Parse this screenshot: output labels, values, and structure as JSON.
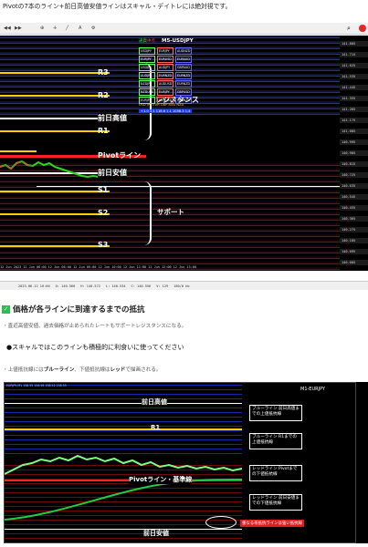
{
  "header": {
    "title": "Pivotの7本のライン+前日高値安値ラインはスキャル・デイトレには絶対視です。"
  },
  "toolbar": {
    "icons": [
      "left-arrow-icon",
      "right-arrow-icon",
      "zoom-in-icon",
      "crosshair-icon",
      "trendline-icon",
      "text-icon",
      "settings-icon"
    ]
  },
  "chart1": {
    "symbol": "M5-USDJPY",
    "top_labels": [
      "通貨",
      "中点"
    ],
    "labels": {
      "r3": "R3",
      "r2": "R2",
      "prev_high": "前日高値",
      "r1": "R1",
      "pivot": "Pivotライン",
      "prev_low": "前日安値",
      "s1": "S1",
      "s2": "S2",
      "s3": "S3"
    },
    "resistance": "レジスタンス",
    "support": "サポート",
    "currency_strip": "USD JPY EUR GBP AUD NZD",
    "currency_values": "+1.0  3.1  118.6  1.1  1058.3  1.4",
    "pairs": [
      [
        "USDJPY",
        "EURJPY",
        "AUDNZD"
      ],
      [
        "EURJPY",
        "EURUSD",
        "EURAUD"
      ],
      [
        "USDJPY",
        "AUDJPY",
        "GBPAUD"
      ],
      [
        "AUDJPY",
        "EURNZD",
        "EURNZD"
      ],
      [
        "NZDJPY",
        "AUDUSD",
        "EURNZD"
      ],
      [
        "NZDUSD",
        "EURJPY",
        "GBPUSD"
      ],
      [
        "EURJPY",
        "NZDUSD",
        "GBPNZD"
      ]
    ],
    "price_ticks": [
      "141.805",
      "141.715",
      "141.625",
      "141.535",
      "141.445",
      "141.355",
      "141.265",
      "141.175",
      "141.085",
      "140.995",
      "140.905",
      "140.815",
      "140.725",
      "140.635",
      "140.545",
      "140.455",
      "140.365",
      "140.275",
      "140.185",
      "140.095",
      "140.005"
    ],
    "time_axis": "12 Jun 2023  12 Jun 06:00  12 Jun 08:00  12 Jun 09:00  12 Jun 10:00  12 Jun 11:00  12 Jun 12:00  12 Jun 13:00",
    "status_bar": [
      "2023.06.12 10:00",
      "O: 140.560",
      "H: 140.572",
      "L: 140.534",
      "C: 140.556",
      "V: 129",
      "180/0 kb"
    ]
  },
  "section": {
    "heading": "価格が各ラインに到達するまでの抵抗",
    "body1": "・直近高値安値、過去価格が止められたレートもサポートレジスタンスになる。",
    "bullet": "●スキャルではこのラインも積極的に利食いに使ってください",
    "body2_pre": "・上値抵抗線には",
    "body2_blue": "ブルーライン",
    "body2_mid": "、下値抵抗線は",
    "body2_red": "レッド",
    "body2_post": "で描画される。"
  },
  "chart2": {
    "symbol": "M1-EURJPY",
    "labels": {
      "prev_high": "前日高値",
      "r1": "R1",
      "pivot": "Pivotライン・基準線",
      "prev_low": "前日安値"
    },
    "notes": [
      "ブルーライン 前日高値までの上値抵抗線",
      "ブルーライン R1までの上値抵抗線",
      "レッドライン Pivotまでの下値抵抗線",
      "レッドライン 前日安値までの下値抵抗線"
    ],
    "red_note": "重なる帯抵抗ラインは強い抵抗線",
    "status": "EURJPY,M1  158.55 158.56 158.52 158.55"
  }
}
